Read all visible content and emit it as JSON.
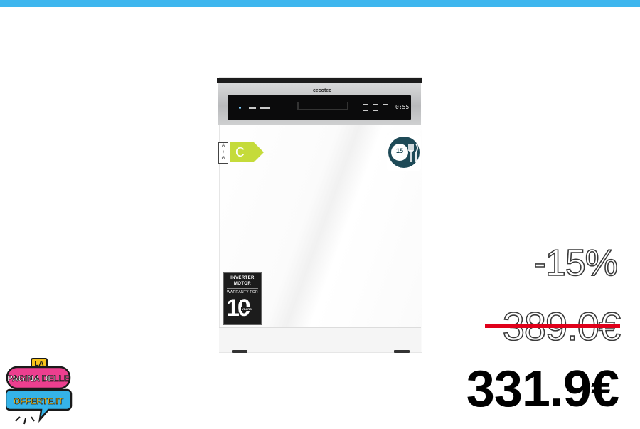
{
  "colors": {
    "top_bar": "#3eb6ee",
    "strike_line": "#e0001a",
    "new_price": "#000000",
    "logo_pink": "#ec3f8f",
    "logo_blue": "#35b3e8",
    "logo_yellow": "#f7c21a",
    "energy_green": "#c5db3a",
    "badge_teal": "#1e4a57"
  },
  "product": {
    "brand": "cecotec",
    "display_time": "0:55",
    "energy_class": "C",
    "energy_scale_top": "A",
    "energy_scale_bottom": "G",
    "place_settings": "15",
    "inverter_line1": "INVERTER",
    "inverter_line2": "MOTOR",
    "inverter_warranty": "WARRANTY FOR",
    "inverter_number": "10",
    "inverter_unit": "YEARS",
    "icons": [
      "energy-label-icon",
      "cutlery-icon",
      "inverter-badge-icon"
    ]
  },
  "pricing": {
    "discount": "-15%",
    "old_price": "389.0€",
    "new_price": "331.9€"
  },
  "logo": {
    "line1": "LA",
    "line2": "PAGINA DELLE",
    "line3": "OFFERTE.IT"
  }
}
